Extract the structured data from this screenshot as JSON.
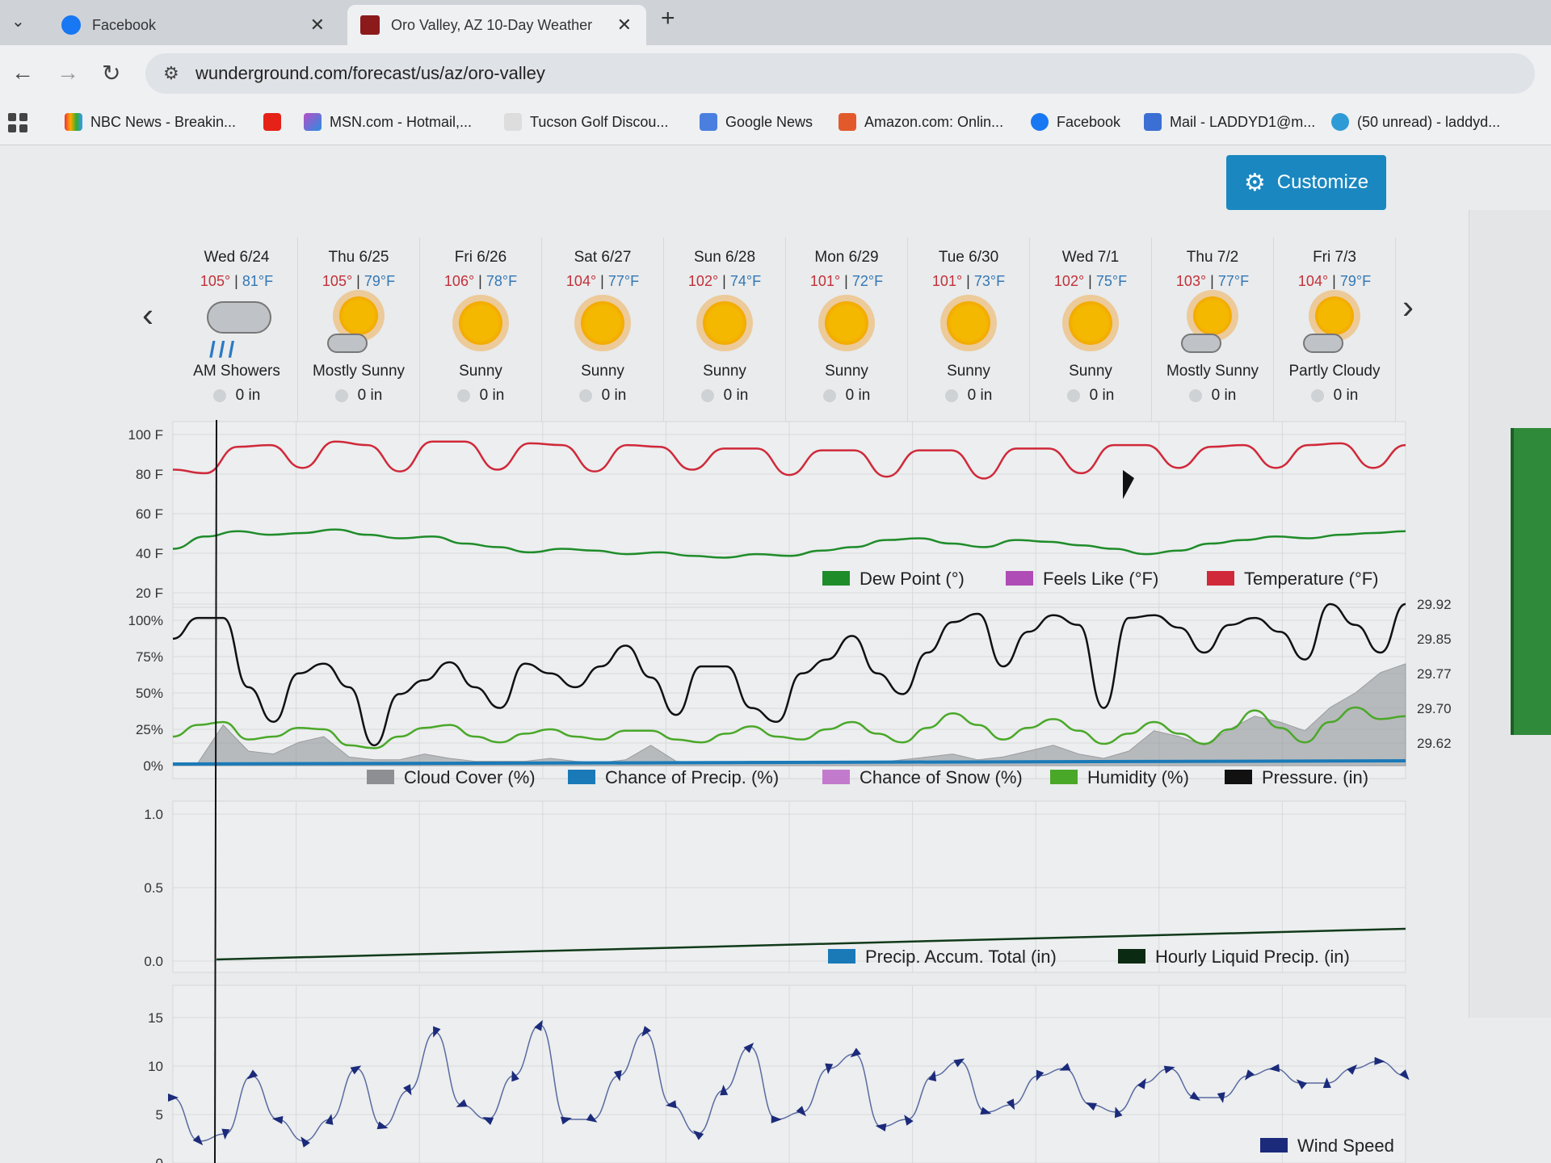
{
  "browser": {
    "tabs": [
      {
        "title": "Facebook",
        "active": false
      },
      {
        "title": "Oro Valley, AZ 10-Day Weather",
        "active": true
      }
    ],
    "url": "wunderground.com/forecast/us/az/oro-valley",
    "bookmarks": [
      "NBC News - Breakin...",
      "MSN.com - Hotmail,...",
      "Tucson Golf Discou...",
      "Google News",
      "Amazon.com: Onlin...",
      "Facebook",
      "Mail - LADDYD1@m...",
      "(50 unread) - laddyd..."
    ]
  },
  "customize_label": "Customize",
  "days": [
    {
      "date": "Wed 6/24",
      "hi": "105°",
      "lo": "81°F",
      "cond": "AM Showers",
      "precip": "0 in",
      "icon": "cloud-rain-icon"
    },
    {
      "date": "Thu 6/25",
      "hi": "105°",
      "lo": "79°F",
      "cond": "Mostly Sunny",
      "precip": "0 in",
      "icon": "mostly-sunny-icon"
    },
    {
      "date": "Fri 6/26",
      "hi": "106°",
      "lo": "78°F",
      "cond": "Sunny",
      "precip": "0 in",
      "icon": "sun-icon"
    },
    {
      "date": "Sat 6/27",
      "hi": "104°",
      "lo": "77°F",
      "cond": "Sunny",
      "precip": "0 in",
      "icon": "sun-icon"
    },
    {
      "date": "Sun 6/28",
      "hi": "102°",
      "lo": "74°F",
      "cond": "Sunny",
      "precip": "0 in",
      "icon": "sun-icon"
    },
    {
      "date": "Mon 6/29",
      "hi": "101°",
      "lo": "72°F",
      "cond": "Sunny",
      "precip": "0 in",
      "icon": "sun-icon"
    },
    {
      "date": "Tue 6/30",
      "hi": "101°",
      "lo": "73°F",
      "cond": "Sunny",
      "precip": "0 in",
      "icon": "sun-icon"
    },
    {
      "date": "Wed 7/1",
      "hi": "102°",
      "lo": "75°F",
      "cond": "Sunny",
      "precip": "0 in",
      "icon": "sun-icon"
    },
    {
      "date": "Thu 7/2",
      "hi": "103°",
      "lo": "77°F",
      "cond": "Mostly Sunny",
      "precip": "0 in",
      "icon": "mostly-sunny-icon"
    },
    {
      "date": "Fri 7/3",
      "hi": "104°",
      "lo": "79°F",
      "cond": "Partly Cloudy",
      "precip": "0 in",
      "icon": "partly-cloudy-icon"
    }
  ],
  "colors": {
    "hi": "#c2303a",
    "lo": "#3477b5",
    "accent": "#1a87c0",
    "temperature": "#d0293a",
    "dew_point": "#1f8c2a",
    "humidity": "#4aa829",
    "pressure": "#111111",
    "cloud_cover": "#8d8f92",
    "precip": "#1a7ab8",
    "snow": "#c27acc",
    "feels_like": "#b04cb5",
    "wind": "#1b2a7a"
  },
  "chart_data": [
    {
      "type": "line",
      "title": "",
      "y_ticks": [
        "100 F",
        "80 F",
        "60 F",
        "40 F",
        "20 F"
      ],
      "ylim": [
        20,
        110
      ],
      "x_days": 10,
      "legend": [
        "Dew Point (°)",
        "Feels Like (°F)",
        "Temperature (°F)"
      ],
      "series": [
        {
          "name": "Temperature (°F)",
          "values": [
            90,
            88,
            103,
            104,
            91,
            106,
            104,
            89,
            106,
            106,
            90,
            105,
            104,
            89,
            104,
            103,
            90,
            102,
            102,
            87,
            101,
            101,
            86,
            101,
            101,
            85,
            102,
            102,
            88,
            104,
            104,
            91,
            103,
            104,
            91,
            104,
            105,
            91,
            104
          ]
        },
        {
          "name": "Dew Point (°)",
          "values": [
            45,
            52,
            55,
            53,
            54,
            56,
            53,
            51,
            52,
            48,
            46,
            43,
            45,
            44,
            42,
            43,
            41,
            40,
            42,
            41,
            44,
            46,
            50,
            51,
            48,
            46,
            50,
            49,
            47,
            45,
            42,
            44,
            48,
            50,
            52,
            51,
            53,
            54,
            55
          ]
        }
      ]
    },
    {
      "type": "line",
      "y_ticks": [
        "100%",
        "75%",
        "50%",
        "25%",
        "0%"
      ],
      "y2_ticks": [
        "29.92",
        "29.85",
        "29.77",
        "29.70",
        "29.62"
      ],
      "ylim": [
        0,
        100
      ],
      "legend": [
        "Cloud Cover (%)",
        "Chance of Precip. (%)",
        "Chance of Snow (%)",
        "Humidity (%)",
        "Pressure. (in)"
      ],
      "series": [
        {
          "name": "Pressure. (in)",
          "values": [
            80,
            95,
            95,
            45,
            20,
            55,
            62,
            45,
            3,
            40,
            50,
            63,
            45,
            30,
            62,
            55,
            45,
            60,
            75,
            52,
            25,
            60,
            60,
            30,
            20,
            55,
            65,
            82,
            55,
            40,
            70,
            92,
            98,
            60,
            85,
            97,
            90,
            30,
            95,
            97,
            88,
            70,
            90,
            95,
            85,
            65,
            105,
            90,
            70,
            105
          ]
        },
        {
          "name": "Humidity (%)",
          "values": [
            20,
            28,
            30,
            18,
            20,
            26,
            25,
            14,
            12,
            20,
            26,
            28,
            20,
            16,
            22,
            25,
            20,
            18,
            24,
            24,
            18,
            16,
            22,
            27,
            20,
            18,
            25,
            30,
            22,
            16,
            26,
            36,
            28,
            18,
            26,
            32,
            24,
            15,
            22,
            30,
            22,
            15,
            25,
            38,
            26,
            16,
            30,
            40,
            32,
            34
          ]
        },
        {
          "name": "Cloud Cover (%)",
          "values": [
            0,
            2,
            28,
            10,
            8,
            16,
            20,
            6,
            4,
            4,
            8,
            5,
            3,
            3,
            3,
            5,
            3,
            2,
            4,
            14,
            3,
            2,
            2,
            3,
            3,
            2,
            3,
            2,
            2,
            4,
            6,
            8,
            4,
            6,
            10,
            14,
            8,
            5,
            10,
            24,
            20,
            14,
            25,
            34,
            30,
            24,
            40,
            50,
            64,
            70
          ]
        }
      ]
    },
    {
      "type": "line",
      "y_ticks": [
        "1.0",
        "0.5",
        "0.0"
      ],
      "ylim": [
        0,
        1
      ],
      "legend": [
        "Precip. Accum. Total (in)",
        "Hourly Liquid Precip. (in)"
      ],
      "series": [
        {
          "name": "Hourly Liquid Precip. (in)",
          "values": [
            0,
            0,
            0,
            0,
            0,
            0,
            0,
            0,
            0,
            0
          ]
        }
      ]
    },
    {
      "type": "line",
      "y_ticks": [
        "15",
        "10",
        "5",
        "0"
      ],
      "ylim": [
        0,
        20
      ],
      "legend": [
        "Wind Speed"
      ],
      "series": [
        {
          "name": "Wind Speed",
          "values": [
            9,
            3,
            4,
            12,
            6,
            3,
            6,
            13,
            5,
            10,
            18,
            8,
            6,
            12,
            19,
            6,
            6,
            12,
            18,
            8,
            4,
            10,
            16,
            6,
            7,
            13,
            15,
            5,
            6,
            12,
            14,
            7,
            8,
            12,
            13,
            8,
            7,
            11,
            13,
            9,
            9,
            12,
            13,
            11,
            11,
            13,
            14,
            12
          ]
        }
      ]
    }
  ]
}
